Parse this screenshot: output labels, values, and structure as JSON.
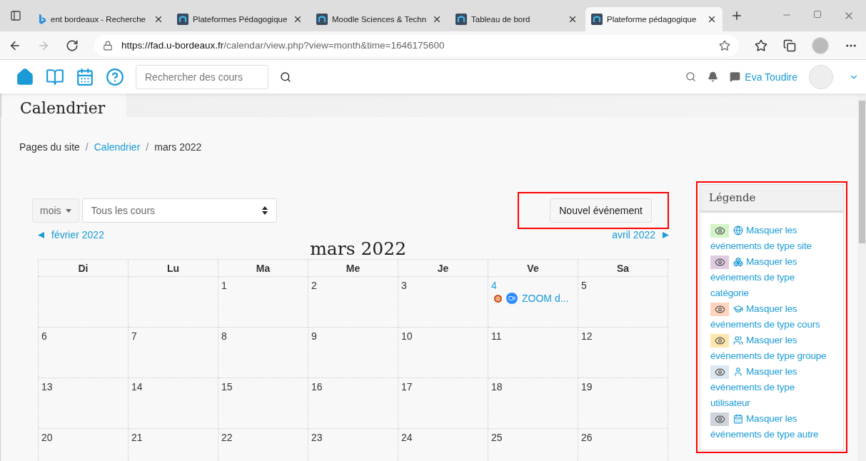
{
  "browser": {
    "tabs": [
      {
        "title": "ent bordeaux - Recherche",
        "selected": false
      },
      {
        "title": "Plateformes Pédagogique",
        "selected": false
      },
      {
        "title": "Moodle Sciences & Techn",
        "selected": false
      },
      {
        "title": "Tableau de bord",
        "selected": false
      },
      {
        "title": "Plateforme pédagogique",
        "selected": true
      }
    ],
    "url_host": "https://fad.u-bordeaux.fr",
    "url_path": "/calendar/view.php?view=month&time=1646175600"
  },
  "navbar": {
    "search_placeholder": "Rechercher des cours",
    "user": "Eva Toudire"
  },
  "header": {
    "title": "Calendrier"
  },
  "breadcrumb": [
    {
      "label": "Pages du site",
      "link": false
    },
    {
      "separator": "/",
      "label": "Calendrier",
      "link": true
    },
    {
      "separator": "/",
      "label": "mars 2022",
      "link": false
    }
  ],
  "controls": {
    "view": "mois",
    "course": "Tous les cours",
    "new_event": "Nouvel événement"
  },
  "calendar": {
    "prev": "février 2022",
    "month": "mars 2022",
    "next": "avril 2022",
    "weekdays": [
      "Di",
      "Lu",
      "Ma",
      "Me",
      "Je",
      "Ve",
      "Sa"
    ],
    "weeks": [
      [
        {
          "kind": "blank"
        },
        {
          "kind": "blank"
        },
        {
          "day": "1"
        },
        {
          "day": "2"
        },
        {
          "day": "3"
        },
        {
          "day": "4",
          "events": [
            {
              "title": "ZOOM d..."
            }
          ]
        },
        {
          "day": "5"
        }
      ],
      [
        {
          "day": "6"
        },
        {
          "day": "7"
        },
        {
          "day": "8"
        },
        {
          "day": "9"
        },
        {
          "day": "10"
        },
        {
          "day": "11"
        },
        {
          "day": "12"
        }
      ],
      [
        {
          "day": "13"
        },
        {
          "day": "14"
        },
        {
          "day": "15"
        },
        {
          "day": "16"
        },
        {
          "day": "17"
        },
        {
          "day": "18"
        },
        {
          "day": "19"
        }
      ],
      [
        {
          "day": "20"
        },
        {
          "day": "21"
        },
        {
          "day": "22"
        },
        {
          "day": "23"
        },
        {
          "day": "24"
        },
        {
          "day": "25"
        },
        {
          "day": "26"
        }
      ]
    ]
  },
  "legend": {
    "title": "Légende",
    "items": [
      {
        "kind": "site",
        "color": "#d3f4c9",
        "text": "Masquer les événements de type site"
      },
      {
        "kind": "category",
        "color": "#e0cbe0",
        "text": "Masquer les événements de type catégorie"
      },
      {
        "kind": "course",
        "color": "#ffd3bd",
        "text": "Masquer les événements de type cours"
      },
      {
        "kind": "group",
        "color": "#fee7ae",
        "text": "Masquer les événements de type groupe"
      },
      {
        "kind": "user",
        "color": "#dce7ef",
        "text": "Masquer les événements de type utilisateur"
      },
      {
        "kind": "other",
        "color": "#ced4da",
        "text": "Masquer les événements de type autre"
      }
    ]
  }
}
